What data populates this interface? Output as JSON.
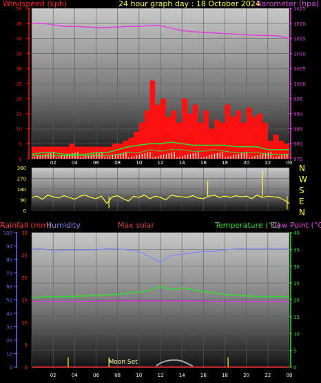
{
  "header": {
    "left_label": "Windspeed (kph)",
    "center_label": "24 hour graph day : 18 October 2024",
    "right_label": "Barometer (hpa)"
  },
  "mid_labels": {
    "rainfall": "Rainfall (mm)",
    "humidity": "Humidity",
    "max_solar": "Max solar",
    "temperature": "Temperature (°C)",
    "dew_point": "Dew Point (°C)"
  },
  "compass": [
    "N",
    "W",
    "S",
    "E",
    "N"
  ],
  "moon_label": "Moon Set",
  "colors": {
    "wind": "#ff1010",
    "barometer": "#e040e0",
    "gust_avg": "#33dd33",
    "direction": "#ffff33",
    "humidity": "#8c8cf0",
    "temperature": "#33dd33",
    "dew_point": "#dd33dd",
    "solar": "#aaaaaa",
    "rain": "#ff3333",
    "axis_left_bottom": "#6a6af0",
    "axis_right_bottom": "#33dd33",
    "x_tick": "#ffffff"
  },
  "chart_data": [
    {
      "type": "bar",
      "name": "wind-and-barometer",
      "x_ticks": [
        "02",
        "04",
        "06",
        "08",
        "10",
        "12",
        "14",
        "16",
        "18",
        "20",
        "22",
        "00"
      ],
      "xlim": [
        0,
        24
      ],
      "left_axis": {
        "label": "Windspeed (kph)",
        "ticks": [
          0,
          5,
          10,
          15,
          20,
          25,
          30,
          35,
          40,
          45,
          50
        ],
        "ylim": [
          0,
          50
        ]
      },
      "right_axis": {
        "label": "Barometer (hpa)",
        "ticks": [
          975,
          980,
          985,
          990,
          995,
          1000,
          1005,
          1010,
          1015,
          1020,
          1025
        ],
        "ylim": [
          975,
          1025
        ]
      },
      "series": [
        {
          "name": "Barometer (hpa)",
          "kind": "line",
          "axis": "right",
          "x": [
            0,
            1,
            2,
            3,
            4,
            5,
            6,
            7,
            8,
            9,
            10,
            11,
            12,
            13,
            14,
            15,
            16,
            17,
            18,
            19,
            20,
            21,
            22,
            23,
            24
          ],
          "y": [
            1020,
            1020,
            1019.5,
            1019,
            1019,
            1018.8,
            1018.6,
            1018.6,
            1018.8,
            1019,
            1019,
            1019.2,
            1019.2,
            1018.4,
            1017.6,
            1017.2,
            1017,
            1016.8,
            1016.6,
            1016.4,
            1016.2,
            1016,
            1016,
            1015.8,
            1015
          ]
        },
        {
          "name": "Wind gust",
          "kind": "bars",
          "axis": "left",
          "x": [
            0,
            0.5,
            1,
            1.5,
            2,
            2.5,
            3,
            3.5,
            4,
            4.5,
            5,
            5.5,
            6,
            6.5,
            7,
            7.5,
            8,
            8.5,
            9,
            9.5,
            10,
            10.5,
            11,
            11.5,
            12,
            12.5,
            13,
            13.5,
            14,
            14.5,
            15,
            15.5,
            16,
            16.5,
            17,
            17.5,
            18,
            18.5,
            19,
            19.5,
            20,
            20.5,
            21,
            21.5,
            22,
            22.5,
            23,
            23.5
          ],
          "y": [
            4,
            4,
            4,
            4,
            4,
            4,
            4,
            5,
            4,
            4,
            4,
            4,
            4,
            4,
            4,
            5,
            5,
            6,
            7,
            9,
            12,
            16,
            26,
            18,
            20,
            14,
            16,
            12,
            20,
            15,
            18,
            12,
            16,
            10,
            13,
            12,
            18,
            14,
            16,
            12,
            17,
            14,
            15,
            12,
            6,
            8,
            6,
            5
          ]
        },
        {
          "name": "Wind average",
          "kind": "line",
          "axis": "left",
          "x": [
            0,
            1,
            2,
            3,
            4,
            5,
            6,
            7,
            8,
            9,
            10,
            11,
            12,
            13,
            14,
            15,
            16,
            17,
            18,
            19,
            20,
            21,
            22,
            23,
            24
          ],
          "y": [
            1,
            1,
            1,
            1,
            1,
            1,
            1,
            1,
            1.5,
            2,
            2,
            3,
            2.5,
            3,
            3,
            2.5,
            2.5,
            3,
            2.5,
            2,
            2,
            2,
            1.5,
            1.5,
            1.5
          ]
        },
        {
          "name": "Wind gust line",
          "kind": "line",
          "axis": "left",
          "x": [
            0,
            1,
            2,
            3,
            4,
            5,
            6,
            7,
            8,
            9,
            10,
            11,
            12,
            13,
            14,
            15,
            16,
            17,
            18,
            19,
            20,
            21,
            22,
            23,
            24
          ],
          "y": [
            1.5,
            2,
            2,
            1.5,
            1.5,
            1.5,
            2,
            2,
            3,
            4,
            4.5,
            5,
            5,
            5.5,
            5,
            4.5,
            4.5,
            4.5,
            4.5,
            4,
            4,
            4,
            3,
            3,
            3
          ]
        }
      ]
    },
    {
      "type": "line",
      "name": "wind-direction",
      "x_ticks": [],
      "xlim": [
        0,
        24
      ],
      "left_axis": {
        "ticks": [
          0,
          90,
          180,
          270,
          360
        ],
        "ylim": [
          0,
          360
        ]
      },
      "series": [
        {
          "name": "Wind direction",
          "x": [
            0,
            0.5,
            1,
            1.5,
            2,
            2.5,
            3,
            3.5,
            4,
            4.5,
            5,
            5.5,
            6,
            6.5,
            7,
            7.5,
            8,
            8.5,
            9,
            9.5,
            10,
            10.5,
            11,
            11.5,
            12,
            12.5,
            13,
            13.5,
            14,
            14.5,
            15,
            15.5,
            16,
            16.5,
            17,
            17.5,
            18,
            18.5,
            19,
            19.5,
            20,
            20.5,
            21,
            21.5,
            22,
            22.5,
            23,
            23.5,
            24
          ],
          "y": [
            110,
            120,
            95,
            130,
            115,
            105,
            125,
            110,
            95,
            120,
            130,
            110,
            100,
            120,
            60,
            115,
            125,
            100,
            80,
            120,
            110,
            130,
            100,
            120,
            110,
            90,
            130,
            120,
            115,
            110,
            125,
            105,
            100,
            120,
            130,
            110,
            120,
            110,
            125,
            115,
            120,
            100,
            130,
            110,
            120,
            115,
            110,
            90,
            60
          ]
        }
      ],
      "spikes": [
        {
          "x": 16.4,
          "y": 250
        },
        {
          "x": 21.5,
          "y": 330
        },
        {
          "x": 7.2,
          "y": 20
        },
        {
          "x": 23.8,
          "y": 10
        }
      ]
    },
    {
      "type": "line",
      "name": "temperature-humidity",
      "x_ticks": [
        "02",
        "04",
        "06",
        "08",
        "10",
        "12",
        "14",
        "16",
        "18",
        "20",
        "22",
        "00"
      ],
      "xlim": [
        0,
        24
      ],
      "left_axis_humidity": {
        "label": "Humidity",
        "ticks": [
          0,
          10,
          20,
          30,
          40,
          50,
          60,
          70,
          80,
          90,
          100
        ],
        "ylim": [
          0,
          100
        ]
      },
      "left_axis_rain": {
        "label": "Rainfall (mm)",
        "ticks": [
          0,
          5,
          10,
          15,
          20,
          25,
          30
        ],
        "ylim": [
          0,
          30
        ]
      },
      "right_axis": {
        "label": "Temperature (°C)",
        "ticks": [
          0,
          5,
          10,
          15,
          20,
          25,
          30,
          35,
          40
        ],
        "ylim": [
          0,
          40
        ]
      },
      "series": [
        {
          "name": "Humidity",
          "axis": "humidity",
          "x": [
            0,
            1,
            2,
            3,
            4,
            5,
            6,
            7,
            8,
            9,
            10,
            11,
            12,
            13,
            14,
            15,
            16,
            17,
            18,
            19,
            20,
            21,
            22,
            23,
            24
          ],
          "y": [
            88,
            88,
            86,
            87,
            87,
            87,
            87,
            88,
            88,
            87,
            86,
            82,
            78,
            83,
            84,
            85,
            86,
            86,
            87,
            88,
            88,
            88,
            88,
            88,
            88
          ]
        },
        {
          "name": "Temperature (°C)",
          "axis": "temp",
          "x": [
            0,
            1,
            2,
            3,
            4,
            5,
            6,
            7,
            8,
            9,
            10,
            11,
            12,
            13,
            14,
            15,
            16,
            17,
            18,
            19,
            20,
            21,
            22,
            23,
            24
          ],
          "y": [
            20.5,
            21,
            21,
            21,
            21,
            21.2,
            21.3,
            21.5,
            21.6,
            22,
            22.3,
            22.8,
            24,
            23,
            23.6,
            23,
            22.5,
            22,
            21.6,
            21.4,
            21.2,
            21,
            21,
            21,
            21
          ]
        },
        {
          "name": "Dew Point (°C)",
          "axis": "temp",
          "x": [
            0,
            1,
            2,
            3,
            4,
            5,
            6,
            7,
            8,
            9,
            10,
            11,
            12,
            13,
            14,
            15,
            16,
            17,
            18,
            19,
            20,
            21,
            22,
            23,
            24
          ],
          "y": [
            19.5,
            19.5,
            19.4,
            19.5,
            19.5,
            19.5,
            19.6,
            19.6,
            19.7,
            19.8,
            19.7,
            19.7,
            19.6,
            19.6,
            19.7,
            19.6,
            19.6,
            19.5,
            19.5,
            19.5,
            19.5,
            19.4,
            19.4,
            19.5,
            19.5
          ]
        },
        {
          "name": "Max solar",
          "axis": "temp",
          "x": [
            11.6,
            12,
            12.5,
            13,
            13.5,
            14,
            14.5,
            15
          ],
          "y": [
            0.4,
            1.2,
            1.8,
            2.1,
            2.1,
            1.8,
            1.1,
            0.3
          ]
        },
        {
          "name": "Rainfall (mm)",
          "axis": "rain",
          "x": [
            0,
            24
          ],
          "y": [
            0,
            0
          ]
        }
      ],
      "moon_markers": [
        3.4,
        7.2,
        18.3
      ],
      "moon_label_x": 7.8
    }
  ]
}
